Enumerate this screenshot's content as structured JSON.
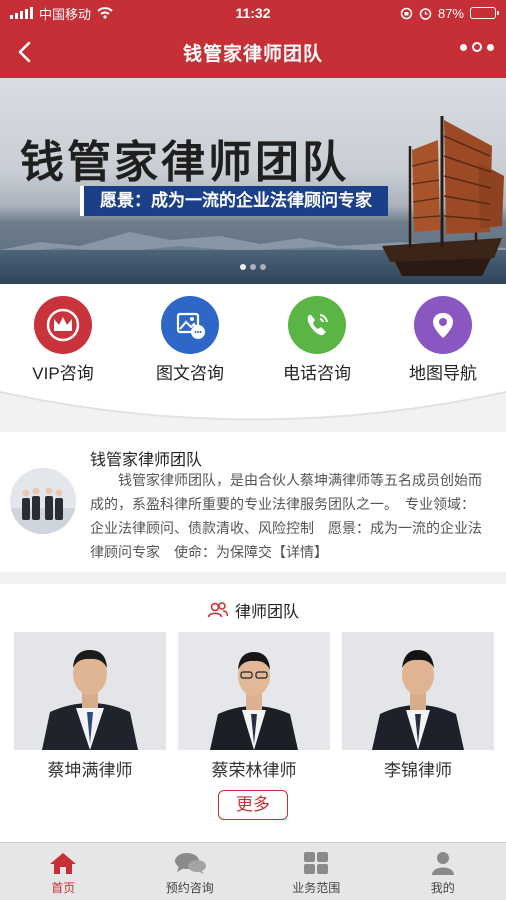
{
  "status_bar": {
    "carrier": "中国移动",
    "time": "11:32",
    "battery": "87%",
    "battery_level": 0.87
  },
  "nav": {
    "title": "钱管家律师团队"
  },
  "banner": {
    "title": "钱管家律师团队",
    "subtitle": "愿景：成为一流的企业法律顾问专家"
  },
  "quick_actions": [
    {
      "label": "VIP咨询",
      "icon": "crown-icon",
      "color": "#c9333b"
    },
    {
      "label": "图文咨询",
      "icon": "image-chat-icon",
      "color": "#2e67c8"
    },
    {
      "label": "电话咨询",
      "icon": "phone-icon",
      "color": "#5bb545"
    },
    {
      "label": "地图导航",
      "icon": "location-pin-icon",
      "color": "#8a57c0"
    }
  ],
  "intro": {
    "title": "钱管家律师团队",
    "text": "钱管家律师团队，是由合伙人蔡坤满律师等五名成员创始而成的，系盈科律所重要的专业法律服务团队之一。　专业领域：企业法律顾问、债款清收、风险控制　愿景：成为一流的企业法律顾问专家　使命：为保障交",
    "more_link": "【详情】"
  },
  "team": {
    "heading": "律师团队",
    "members": [
      {
        "name": "蔡坤满律师"
      },
      {
        "name": "蔡荣林律师"
      },
      {
        "name": "李锦律师"
      }
    ],
    "more_button": "更多"
  },
  "tabbar": [
    {
      "label": "首页",
      "icon": "home-icon",
      "active": true
    },
    {
      "label": "预约咨询",
      "icon": "chat-bubbles-icon",
      "active": false
    },
    {
      "label": "业务范围",
      "icon": "grid-icon",
      "active": false
    },
    {
      "label": "我的",
      "icon": "user-icon",
      "active": false
    }
  ],
  "colors": {
    "brand": "#c62f36",
    "active_tab": "#c62f36"
  }
}
